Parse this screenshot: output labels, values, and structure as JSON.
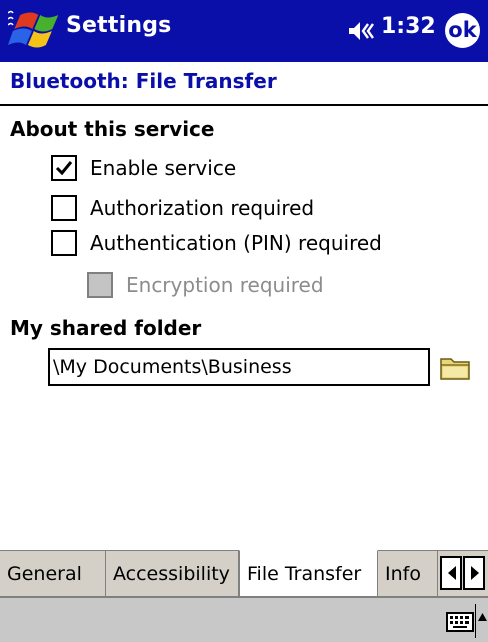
{
  "titlebar": {
    "title": "Settings",
    "start_icon": "windows-flag-icon",
    "volume_icon": "speaker-icon",
    "time": "1:32",
    "ok_label": "ok"
  },
  "page": {
    "title": "Bluetooth: File Transfer"
  },
  "about_section": {
    "heading": "About this service",
    "options": [
      {
        "label": "Enable service",
        "checked": true,
        "enabled": true
      },
      {
        "label": "Authorization required",
        "checked": false,
        "enabled": true
      },
      {
        "label": "Authentication (PIN) required",
        "checked": false,
        "enabled": true
      },
      {
        "label": "Encryption required",
        "checked": false,
        "enabled": false
      }
    ]
  },
  "folder_section": {
    "heading": "My shared folder",
    "value": "\\My Documents\\Business",
    "browse_icon": "folder-icon"
  },
  "tabs": [
    {
      "label": "General",
      "active": false
    },
    {
      "label": "Accessibility",
      "active": false
    },
    {
      "label": "File Transfer",
      "active": true
    },
    {
      "label": "Info",
      "active": false
    }
  ],
  "tab_scroll_icons": [
    "scroll-left-icon",
    "scroll-right-icon"
  ],
  "menubar": {
    "input_icon": "keyboard-icon",
    "input_menu_icon": "input-menu-arrow-icon"
  },
  "colors": {
    "titlebar": "#0a0faa",
    "accent_text": "#0a0faa",
    "tabstrip": "#d4d0c8",
    "menubar": "#c8c8c8",
    "disabled_text": "#8c8c8c"
  }
}
